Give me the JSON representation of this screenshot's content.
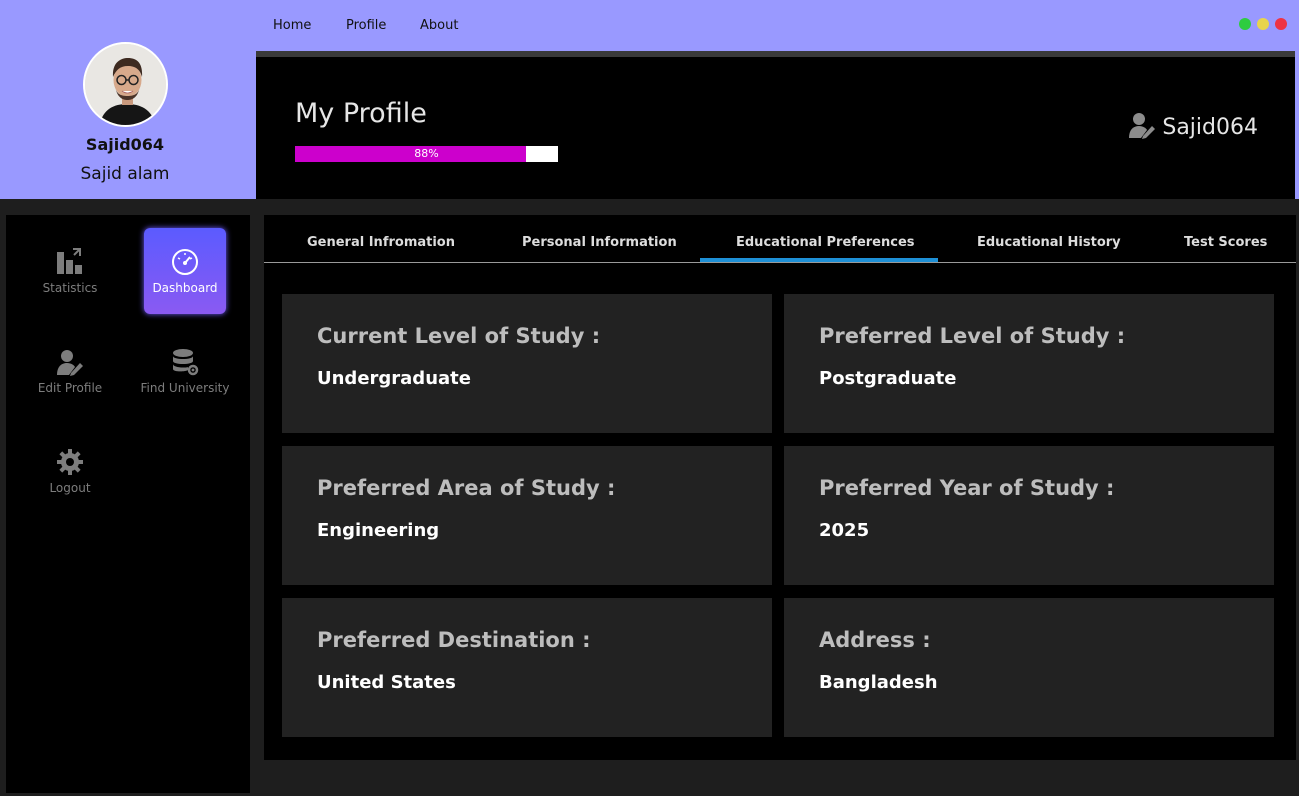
{
  "profile": {
    "username": "Sajid064",
    "full_name": "Sajid alam"
  },
  "nav": {
    "home": "Home",
    "profile": "Profile",
    "about": "About"
  },
  "window_controls": {
    "colors": [
      "#2ecc40",
      "#e8d44d",
      "#ee3344"
    ]
  },
  "header": {
    "title": "My Profile",
    "progress_label": "88%",
    "progress_value": 0.88,
    "username": "Sajid064"
  },
  "sidebar": {
    "items": [
      {
        "label": "Statistics",
        "icon": "bar-chart-icon"
      },
      {
        "label": "Dashboard",
        "icon": "speedometer-icon",
        "active": true
      },
      {
        "label": "Edit Profile",
        "icon": "user-edit-icon"
      },
      {
        "label": "Find University",
        "icon": "database-gear-icon"
      },
      {
        "label": "Logout",
        "icon": "gear-icon"
      }
    ]
  },
  "tabs": [
    {
      "label": "General Infromation"
    },
    {
      "label": "Personal Information"
    },
    {
      "label": "Educational Preferences",
      "active": true
    },
    {
      "label": "Educational History"
    },
    {
      "label": "Test Scores"
    }
  ],
  "cards": [
    {
      "label": "Current Level of Study :",
      "value": "Undergraduate"
    },
    {
      "label": "Preferred Level of Study :",
      "value": "Postgraduate"
    },
    {
      "label": "Preferred Area of Study :",
      "value": "Engineering"
    },
    {
      "label": "Preferred Year of Study :",
      "value": "2025"
    },
    {
      "label": "Preferred Destination :",
      "value": "United States"
    },
    {
      "label": "Address :",
      "value": "Bangladesh"
    }
  ],
  "colors": {
    "accent": "#9999ff",
    "progress": "#cc00cc",
    "tab_underline": "#1e90d6"
  }
}
